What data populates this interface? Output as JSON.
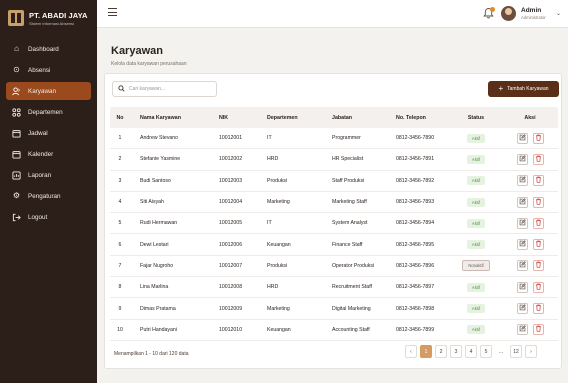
{
  "brand": {
    "name": "PT. ABADI JAYA",
    "subtitle": "Sistem Informasi Absensi"
  },
  "sidebar": {
    "items": [
      {
        "label": "Dashboard",
        "icon": "home-icon",
        "active": false
      },
      {
        "label": "Absensi",
        "icon": "check-circle-icon",
        "active": false
      },
      {
        "label": "Karyawan",
        "icon": "users-icon",
        "active": true
      },
      {
        "label": "Departemen",
        "icon": "grid-icon",
        "active": false
      },
      {
        "label": "Jadwal",
        "icon": "calendar-icon",
        "active": false
      },
      {
        "label": "Kalender",
        "icon": "calendar-icon",
        "active": false
      },
      {
        "label": "Laporan",
        "icon": "report-icon",
        "active": false
      },
      {
        "label": "Pengaturan",
        "icon": "gear-icon",
        "active": false
      },
      {
        "label": "Logout",
        "icon": "logout-icon",
        "active": false
      }
    ]
  },
  "topbar": {
    "user_name": "Admin",
    "user_role": "Administrator"
  },
  "page": {
    "title": "Karyawan",
    "subtitle": "Kelola data karyawan perusahaan"
  },
  "search": {
    "placeholder": "Cari karyawan..."
  },
  "add_button": {
    "label": "Tambah Karyawan"
  },
  "table": {
    "headers": {
      "no": "No",
      "name": "Nama Karyawan",
      "nik": "NIK",
      "dept": "Departemen",
      "job": "Jabatan",
      "tel": "No. Telepon",
      "status": "Status",
      "aksi": "Aksi"
    },
    "rows": [
      {
        "no": "1",
        "name": "Andrew Stevano",
        "nik": "10012001",
        "dept": "IT",
        "job": "Programmer",
        "tel": "0812-3456-7890",
        "status": "Aktif"
      },
      {
        "no": "2",
        "name": "Stefanie Yasmine",
        "nik": "10012002",
        "dept": "HRD",
        "job": "HR Specialist",
        "tel": "0812-3456-7891",
        "status": "Aktif"
      },
      {
        "no": "3",
        "name": "Budi Santoso",
        "nik": "10012003",
        "dept": "Produksi",
        "job": "Staff Produksi",
        "tel": "0812-3456-7892",
        "status": "Aktif"
      },
      {
        "no": "4",
        "name": "Siti Aisyah",
        "nik": "10012004",
        "dept": "Marketing",
        "job": "Marketing Staff",
        "tel": "0812-3456-7893",
        "status": "Aktif"
      },
      {
        "no": "5",
        "name": "Rudi Hermawan",
        "nik": "10012005",
        "dept": "IT",
        "job": "System Analyst",
        "tel": "0812-3456-7894",
        "status": "Aktif"
      },
      {
        "no": "6",
        "name": "Dewi Lestari",
        "nik": "10012006",
        "dept": "Keuangan",
        "job": "Finance Staff",
        "tel": "0812-3456-7895",
        "status": "Aktif"
      },
      {
        "no": "7",
        "name": "Fajar Nugroho",
        "nik": "10012007",
        "dept": "Produksi",
        "job": "Operator Produksi",
        "tel": "0812-3456-7896",
        "status": "Nonaktif"
      },
      {
        "no": "8",
        "name": "Lina Marlina",
        "nik": "10012008",
        "dept": "HRD",
        "job": "Recruitment Staff",
        "tel": "0812-3456-7897",
        "status": "Aktif"
      },
      {
        "no": "9",
        "name": "Dimas Pratama",
        "nik": "10012009",
        "dept": "Marketing",
        "job": "Digital Marketing",
        "tel": "0812-3456-7898",
        "status": "Aktif"
      },
      {
        "no": "10",
        "name": "Putri Handayani",
        "nik": "10012010",
        "dept": "Keuangan",
        "job": "Accounting Staff",
        "tel": "0812-3456-7899",
        "status": "Aktif"
      }
    ]
  },
  "footer": {
    "info": "Menampilkan 1 - 10 dari 120 data"
  },
  "pagination": {
    "prev": "‹",
    "pages": [
      "1",
      "2",
      "3",
      "4",
      "5"
    ],
    "ellipsis": "...",
    "last": "12",
    "next": "›",
    "current": "1"
  },
  "colors": {
    "sidebar_bg": "#2c1f19",
    "active_nav": "#9b4a1d",
    "primary_button": "#5b2f17",
    "active_page": "#d69a63",
    "status_active": "#5d8a4a",
    "delete": "#c83b30"
  }
}
